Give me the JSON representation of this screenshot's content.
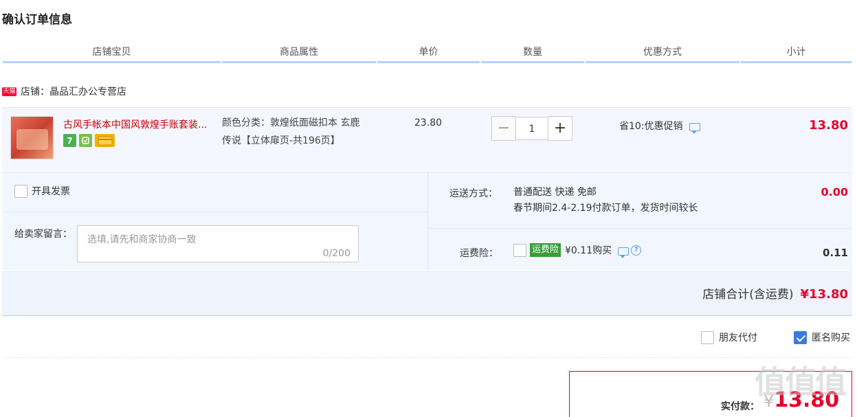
{
  "page_title": "确认订单信息",
  "columns": [
    "店铺宝贝",
    "商品属性",
    "单价",
    "数量",
    "优惠方式",
    "小计"
  ],
  "shop": {
    "badge": "天猫",
    "label": "店铺：晶品汇办公专营店"
  },
  "item": {
    "title": "古风手帐本中国风敦煌手账套装...",
    "service_icons": [
      "seven-day-return-icon",
      "guarantee-icon",
      "credit-card-icon"
    ],
    "service_7": "7",
    "attr_line1": "颜色分类：敦煌纸面磁扣本 玄鹿",
    "attr_line2": "传说【立体扉页-共196页】",
    "price": "23.80",
    "quantity": "1",
    "minus": "−",
    "plus": "+",
    "promo": "省10:优惠促销",
    "subtotal": "13.80"
  },
  "invoice_label": "开具发票",
  "message": {
    "label": "给卖家留言：",
    "placeholder": "选填,请先和商家协商一致",
    "count": "0/200"
  },
  "shipping": {
    "label": "运送方式：",
    "line1": "普通配送 快递 免邮",
    "line2": "春节期间2.4-2.19付款订单，发货时间较长",
    "cost": "0.00"
  },
  "insurance": {
    "label": "运费险：",
    "tag": "运费险",
    "price_text": "¥0.11购买",
    "cost": "0.11",
    "q": "?"
  },
  "shop_total": {
    "label": "店铺合计(含运费)",
    "value": "¥13.80"
  },
  "friend_pay_label": "朋友代付",
  "anonymous_label": "匿名购买",
  "pay": {
    "label": "实付款：",
    "yen": "¥",
    "amount": "13.80"
  },
  "watermark": "值值值"
}
